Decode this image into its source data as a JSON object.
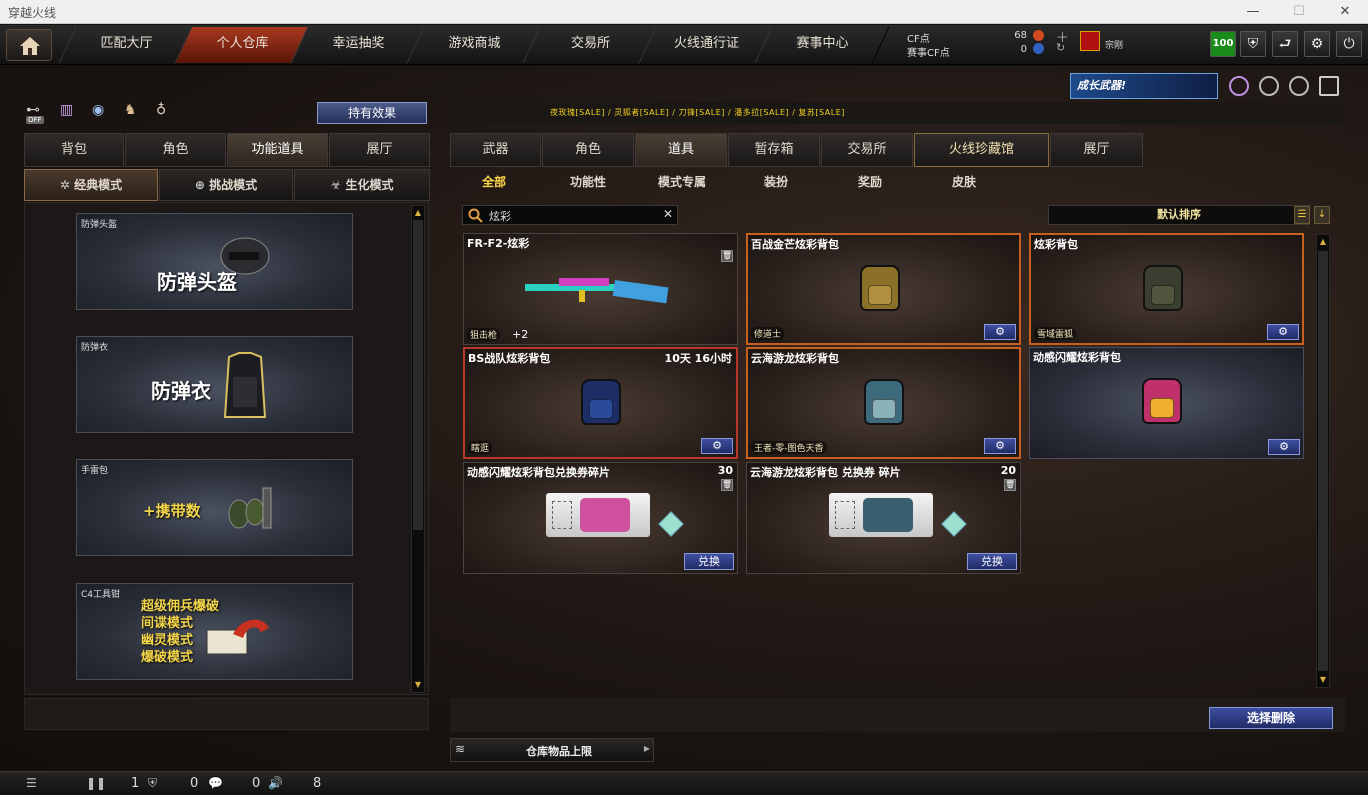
{
  "window": {
    "title": "穿越火线"
  },
  "nav": {
    "tabs": [
      "匹配大厅",
      "个人仓库",
      "幸运抽奖",
      "游戏商城",
      "交易所",
      "火线通行证",
      "赛事中心"
    ],
    "active": 1
  },
  "currency": {
    "cf_label": "CF点",
    "cf_value": "68",
    "event_label": "赛事CF点",
    "event_value": "0"
  },
  "player": {
    "name": "宗刚",
    "level": "100"
  },
  "banner": {
    "text": "成长武器!"
  },
  "left": {
    "effects_button": "持有效果",
    "off_label": "OFF",
    "tabs": [
      "背包",
      "角色",
      "功能道具",
      "展厅"
    ],
    "active_tab": 2,
    "modes": [
      "经典模式",
      "挑战模式",
      "生化模式"
    ],
    "active_mode": 0,
    "items": [
      {
        "caption": "防弹头盔",
        "big": "防弹头盔"
      },
      {
        "caption": "防弹衣",
        "big": "防弹衣"
      },
      {
        "caption": "手雷包",
        "big": "+携带数"
      },
      {
        "caption": "C4工具钳",
        "lines": [
          "超级佣兵爆破",
          "间谍模式",
          "幽灵模式",
          "爆破模式"
        ]
      }
    ]
  },
  "right": {
    "sale_text": "夜玫瑰[SALE]  /  灵狐者[SALE]  /  刀锋[SALE]  /  潘多拉[SALE]  /  复苏[SALE]",
    "tabs": [
      "武器",
      "角色",
      "道具",
      "暂存箱",
      "交易所",
      "火线珍藏馆",
      "展厅"
    ],
    "active_tab": 2,
    "subtabs": [
      "全部",
      "功能性",
      "模式专属",
      "装扮",
      "奖励",
      "皮肤"
    ],
    "active_subtab": 0,
    "search_value": "炫彩",
    "sort_label": "默认排序",
    "cards": [
      {
        "name": "FR-F2-炫彩",
        "tag": "狙击枪",
        "extra": "+2"
      },
      {
        "name": "百战金芒炫彩背包",
        "tag": "修道士"
      },
      {
        "name": "炫彩背包",
        "tag": "雪域雷狐"
      },
      {
        "name": "BS战队炫彩背包",
        "count": "10天 16小时",
        "tag": "瞎逛"
      },
      {
        "name": "云海游龙炫彩背包",
        "tag": "王者-零-图色天香"
      },
      {
        "name": "动感闪耀炫彩背包"
      },
      {
        "name": "动感闪耀炫彩背包兑换券碎片",
        "count": "30",
        "button": "兑换"
      },
      {
        "name": "云海游龙炫彩背包 兑换券 碎片",
        "count": "20",
        "button": "兑换"
      }
    ],
    "select_delete": "选择删除",
    "capacity_label": "仓库物品上限"
  },
  "status": {
    "v1": "1",
    "v2": "0",
    "v3": "0",
    "v4": "8"
  },
  "colors": {
    "accent": "#ffd84a",
    "active_tab": "#a8391f",
    "button": "#2e3c84"
  }
}
